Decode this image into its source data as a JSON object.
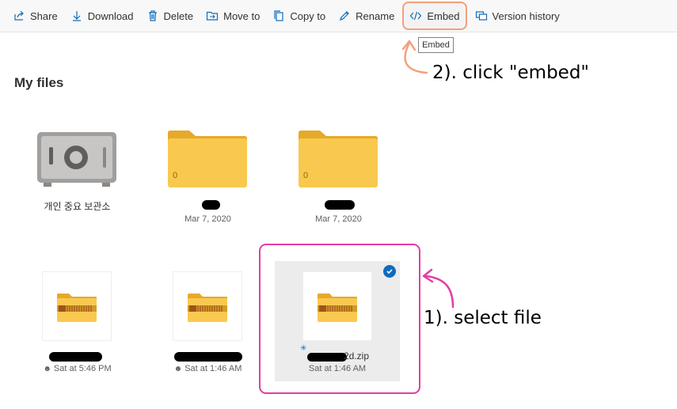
{
  "toolbar": {
    "share": "Share",
    "download": "Download",
    "delete": "Delete",
    "move_to": "Move to",
    "copy_to": "Copy to",
    "rename": "Rename",
    "embed": "Embed",
    "version_history": "Version history"
  },
  "tooltip": "Embed",
  "page_title": "My files",
  "annotations": {
    "step2": "2). click \"embed\"",
    "step1": "1). select file"
  },
  "tiles": [
    {
      "type": "vault",
      "name": "개인 중요 보관소"
    },
    {
      "type": "folder",
      "count": "0",
      "date": "Mar 7, 2020"
    },
    {
      "type": "folder",
      "count": "0",
      "date": "Mar 7, 2020"
    },
    {
      "type": "zip",
      "date": "Sat at 5:46 PM"
    },
    {
      "type": "zip",
      "date": "Sat at 1:46 AM"
    },
    {
      "type": "zip",
      "name_suffix": "2d.zip",
      "date": "Sat at 1:46 AM",
      "selected": true
    }
  ],
  "colors": {
    "folder": "#f9c94f",
    "selection_annotation": "#e23da3",
    "embed_annotation": "#f3a07a",
    "check": "#0f6cbd"
  }
}
